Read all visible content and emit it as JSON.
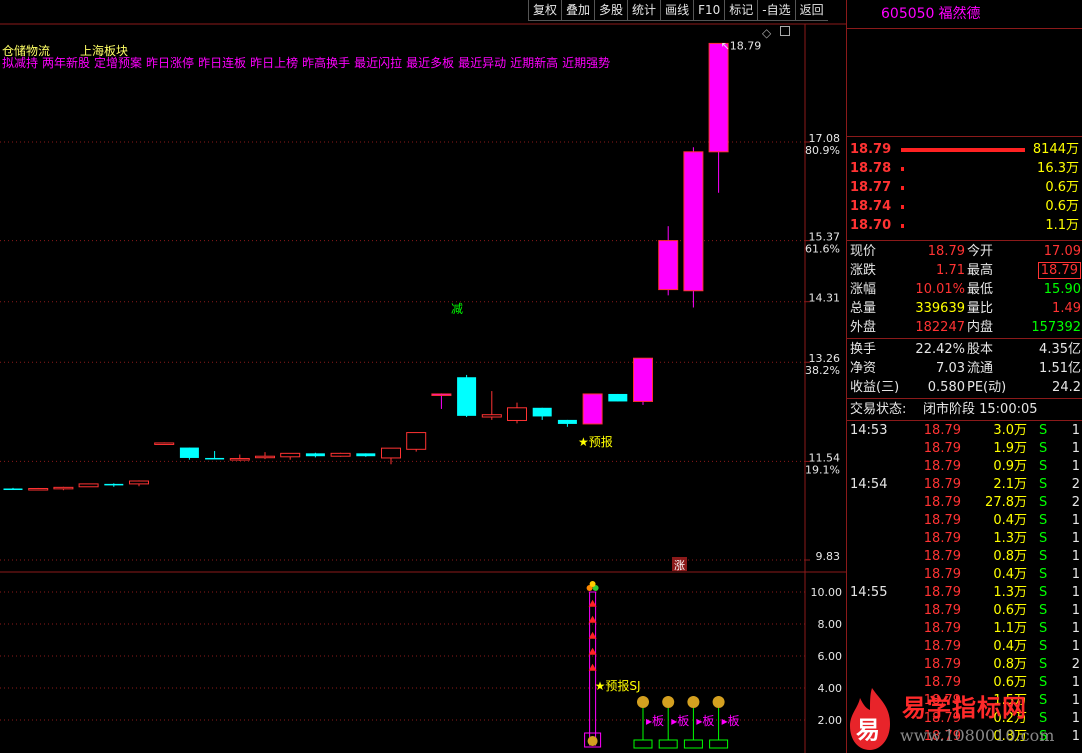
{
  "toolbar": {
    "items": [
      "复权",
      "叠加",
      "多股",
      "统计",
      "画线",
      "F10",
      "标记",
      "-自选",
      "返回"
    ]
  },
  "chart": {
    "top_labels": {
      "left": "仓储物流",
      "right": "上海板块"
    },
    "indicator_labels": [
      "拟减持",
      "两年新股",
      "定增预案",
      "昨日涨停",
      "昨日连板",
      "昨日上榜",
      "昨高换手",
      "最近闪拉",
      "最近多板",
      "最近异动",
      "近期新高",
      "近期强势"
    ],
    "price_ticks": [
      {
        "price": "17.08",
        "pct": "80.9%"
      },
      {
        "price": "15.37",
        "pct": "61.6%"
      },
      {
        "price": "14.31",
        "pct": ""
      },
      {
        "price": "13.26",
        "pct": "38.2%"
      },
      {
        "price": "11.54",
        "pct": "19.1%"
      },
      {
        "price": "9.83",
        "pct": ""
      }
    ],
    "high_label": "18.79",
    "reduce_label": "减",
    "forecast_label": "★预报",
    "zhang_label": "涨",
    "sub_ticks": [
      "10.00",
      "8.00",
      "6.00",
      "4.00",
      "2.00"
    ],
    "sub_forecast_label": "★预报SJ",
    "board_label": "▸板",
    "colors": {
      "up": "#ff3333",
      "down": "#00ffff",
      "limit": "#ff00ff",
      "grid": "#8b1a1a"
    }
  },
  "chart_data": {
    "type": "candlestick",
    "candles": [
      {
        "o": 11.07,
        "h": 11.08,
        "l": 11.06,
        "c": 11.07,
        "color": "cyan"
      },
      {
        "o": 11.05,
        "h": 11.08,
        "l": 11.04,
        "c": 11.07,
        "color": "red"
      },
      {
        "o": 11.07,
        "h": 11.1,
        "l": 11.04,
        "c": 11.09,
        "color": "red"
      },
      {
        "o": 11.1,
        "h": 11.15,
        "l": 11.1,
        "c": 11.15,
        "color": "red"
      },
      {
        "o": 11.15,
        "h": 11.16,
        "l": 11.1,
        "c": 11.13,
        "color": "cyan"
      },
      {
        "o": 11.15,
        "h": 11.21,
        "l": 11.11,
        "c": 11.2,
        "color": "red"
      },
      {
        "o": 11.86,
        "h": 11.87,
        "l": 11.86,
        "c": 11.86,
        "color": "red"
      },
      {
        "o": 11.78,
        "h": 11.78,
        "l": 11.57,
        "c": 11.6,
        "color": "cyan"
      },
      {
        "o": 11.6,
        "h": 11.72,
        "l": 11.58,
        "c": 11.58,
        "color": "cyan"
      },
      {
        "o": 11.57,
        "h": 11.66,
        "l": 11.55,
        "c": 11.59,
        "color": "red"
      },
      {
        "o": 11.62,
        "h": 11.7,
        "l": 11.58,
        "c": 11.63,
        "color": "red"
      },
      {
        "o": 11.62,
        "h": 11.68,
        "l": 11.57,
        "c": 11.68,
        "color": "red"
      },
      {
        "o": 11.68,
        "h": 11.69,
        "l": 11.61,
        "c": 11.63,
        "color": "cyan"
      },
      {
        "o": 11.63,
        "h": 11.69,
        "l": 11.62,
        "c": 11.68,
        "color": "red"
      },
      {
        "o": 11.68,
        "h": 11.68,
        "l": 11.62,
        "c": 11.63,
        "color": "cyan"
      },
      {
        "o": 11.6,
        "h": 11.77,
        "l": 11.49,
        "c": 11.77,
        "color": "red"
      },
      {
        "o": 11.75,
        "h": 12.04,
        "l": 11.71,
        "c": 12.04,
        "color": "red"
      },
      {
        "o": 12.71,
        "h": 12.72,
        "l": 12.45,
        "c": 12.71,
        "color": "limit"
      },
      {
        "o": 13.0,
        "h": 13.04,
        "l": 12.31,
        "c": 12.33,
        "color": "cyan"
      },
      {
        "o": 12.31,
        "h": 12.76,
        "l": 12.26,
        "c": 12.35,
        "color": "red"
      },
      {
        "o": 12.25,
        "h": 12.56,
        "l": 12.2,
        "c": 12.47,
        "color": "red"
      },
      {
        "o": 12.47,
        "h": 12.47,
        "l": 12.26,
        "c": 12.32,
        "color": "cyan"
      },
      {
        "o": 12.26,
        "h": 12.26,
        "l": 12.14,
        "c": 12.19,
        "color": "cyan"
      },
      {
        "o": 12.19,
        "h": 12.71,
        "l": 12.19,
        "c": 12.71,
        "color": "limit"
      },
      {
        "o": 12.71,
        "h": 12.71,
        "l": 12.58,
        "c": 12.58,
        "color": "cyan"
      },
      {
        "o": 12.58,
        "h": 13.33,
        "l": 12.52,
        "c": 13.33,
        "color": "limit"
      },
      {
        "o": 14.52,
        "h": 15.62,
        "l": 14.42,
        "c": 15.37,
        "color": "limit"
      },
      {
        "o": 14.5,
        "h": 16.99,
        "l": 14.21,
        "c": 16.91,
        "color": "limit"
      },
      {
        "o": 16.91,
        "h": 18.79,
        "l": 16.2,
        "c": 18.79,
        "color": "limit"
      }
    ],
    "sub_indicator": {
      "ylim": [
        0,
        11
      ],
      "bar_index": 23,
      "bar_value": 10.0,
      "marker_values": [
        2.0,
        2.0,
        2.0,
        2.0
      ],
      "marker_indices": [
        25,
        26,
        27,
        28
      ]
    }
  },
  "quote": {
    "code": "605050",
    "name": "福然德",
    "order_book": [
      {
        "price": "18.79",
        "vol": "8144万"
      },
      {
        "price": "18.78",
        "vol": "16.3万"
      },
      {
        "price": "18.77",
        "vol": "0.6万"
      },
      {
        "price": "18.74",
        "vol": "0.6万"
      },
      {
        "price": "18.70",
        "vol": "1.1万"
      }
    ],
    "stats": [
      {
        "k1": "现价",
        "v1": "18.79",
        "c1": "red",
        "k2": "今开",
        "v2": "17.09",
        "c2": "red"
      },
      {
        "k1": "涨跌",
        "v1": "1.71",
        "c1": "red",
        "k2": "最高",
        "v2": "18.79",
        "c2": "red"
      },
      {
        "k1": "涨幅",
        "v1": "10.01%",
        "c1": "red",
        "k2": "最低",
        "v2": "15.90",
        "c2": "green"
      },
      {
        "k1": "总量",
        "v1": "339639",
        "c1": "yellow",
        "k2": "量比",
        "v2": "1.49",
        "c2": "red"
      },
      {
        "k1": "外盘",
        "v1": "182247",
        "c1": "red",
        "k2": "内盘",
        "v2": "157392",
        "c2": "green"
      }
    ],
    "stats2": [
      {
        "k1": "换手",
        "v1": "22.42%",
        "k2": "股本",
        "v2": "4.35亿"
      },
      {
        "k1": "净资",
        "v1": "7.03",
        "k2": "流通",
        "v2": "1.51亿"
      },
      {
        "k1": "收益(三)",
        "v1": "0.580",
        "k2": "PE(动)",
        "v2": "24.2"
      }
    ],
    "status_label": "交易状态:",
    "status_value": "闭市阶段 15:00:05",
    "ticks": [
      {
        "time": "14:53",
        "price": "18.79",
        "vol": "3.0万",
        "side": "S",
        "n": "1"
      },
      {
        "time": "",
        "price": "18.79",
        "vol": "1.9万",
        "side": "S",
        "n": "1"
      },
      {
        "time": "",
        "price": "18.79",
        "vol": "0.9万",
        "side": "S",
        "n": "1"
      },
      {
        "time": "14:54",
        "price": "18.79",
        "vol": "2.1万",
        "side": "S",
        "n": "2"
      },
      {
        "time": "",
        "price": "18.79",
        "vol": "27.8万",
        "side": "S",
        "n": "2"
      },
      {
        "time": "",
        "price": "18.79",
        "vol": "0.4万",
        "side": "S",
        "n": "1"
      },
      {
        "time": "",
        "price": "18.79",
        "vol": "1.3万",
        "side": "S",
        "n": "1"
      },
      {
        "time": "",
        "price": "18.79",
        "vol": "0.8万",
        "side": "S",
        "n": "1"
      },
      {
        "time": "",
        "price": "18.79",
        "vol": "0.4万",
        "side": "S",
        "n": "1"
      },
      {
        "time": "14:55",
        "price": "18.79",
        "vol": "1.3万",
        "side": "S",
        "n": "1"
      },
      {
        "time": "",
        "price": "18.79",
        "vol": "0.6万",
        "side": "S",
        "n": "1"
      },
      {
        "time": "",
        "price": "18.79",
        "vol": "1.1万",
        "side": "S",
        "n": "1"
      },
      {
        "time": "",
        "price": "18.79",
        "vol": "0.4万",
        "side": "S",
        "n": "1"
      },
      {
        "time": "",
        "price": "18.79",
        "vol": "0.8万",
        "side": "S",
        "n": "2"
      },
      {
        "time": "",
        "price": "18.79",
        "vol": "0.6万",
        "side": "S",
        "n": "1"
      },
      {
        "time": "",
        "price": "18.79",
        "vol": "1.5万",
        "side": "S",
        "n": "1"
      },
      {
        "time": "",
        "price": "18.79",
        "vol": "0.2万",
        "side": "S",
        "n": "1"
      },
      {
        "time": "",
        "price": "18.79",
        "vol": "0.8万",
        "side": "S",
        "n": "1"
      }
    ]
  },
  "watermark": {
    "title": "易学指标网",
    "url": "www.1080010.com",
    "logo_char": "易"
  }
}
